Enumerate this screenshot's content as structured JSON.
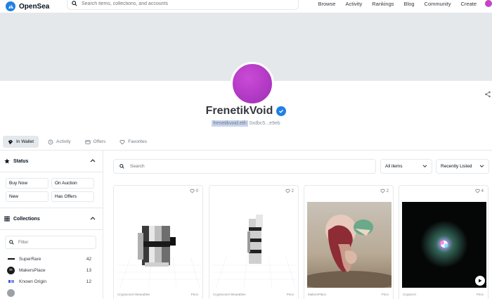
{
  "nav": {
    "logo_text": "OpenSea",
    "search_placeholder": "Search items, collections, and accounts",
    "links": [
      "Browse",
      "Activity",
      "Rankings",
      "Blog",
      "Community",
      "Create"
    ]
  },
  "profile": {
    "name": "FrenetikVoid",
    "ens": "frenetikvoid.eth",
    "address": "0xdbc5...e9eb"
  },
  "tabs": [
    {
      "label": "In Wallet",
      "icon": "wallet-icon",
      "active": true
    },
    {
      "label": "Activity",
      "icon": "activity-icon",
      "active": false
    },
    {
      "label": "Offers",
      "icon": "offers-icon",
      "active": false
    },
    {
      "label": "Favorites",
      "icon": "heart-icon",
      "active": false
    }
  ],
  "sidebar": {
    "status_title": "Status",
    "status_buttons": [
      "Buy Now",
      "On Auction",
      "New",
      "Has Offers"
    ],
    "collections_title": "Collections",
    "filter_placeholder": "Filter",
    "collections": [
      {
        "name": "SuperRare",
        "count": "42",
        "color": "#111111"
      },
      {
        "name": "MakersPlace",
        "count": "13",
        "color": "#1b1b1b"
      },
      {
        "name": "Known Origin",
        "count": "12",
        "color": "#3b5bdb"
      },
      {
        "name": "",
        "count": "",
        "color": "#9aa1a8"
      }
    ]
  },
  "main": {
    "search_placeholder": "Search",
    "filter_select": "All items",
    "sort_select": "Recently Listed"
  },
  "cards": [
    {
      "favorites": "0",
      "collection": "Cryptovoxel Wearables",
      "price_label": "Price"
    },
    {
      "favorites": "2",
      "collection": "Cryptovoxel Wearables",
      "price_label": "Price"
    },
    {
      "favorites": "2",
      "collection": "MakersPlace",
      "price_label": "Price"
    },
    {
      "favorites": "4",
      "collection": "CryptoArt",
      "price_label": "Price"
    }
  ],
  "colors": {
    "brand": "#2081e2",
    "avatar": "#b33ac4",
    "banner": "#e5e8eb"
  }
}
